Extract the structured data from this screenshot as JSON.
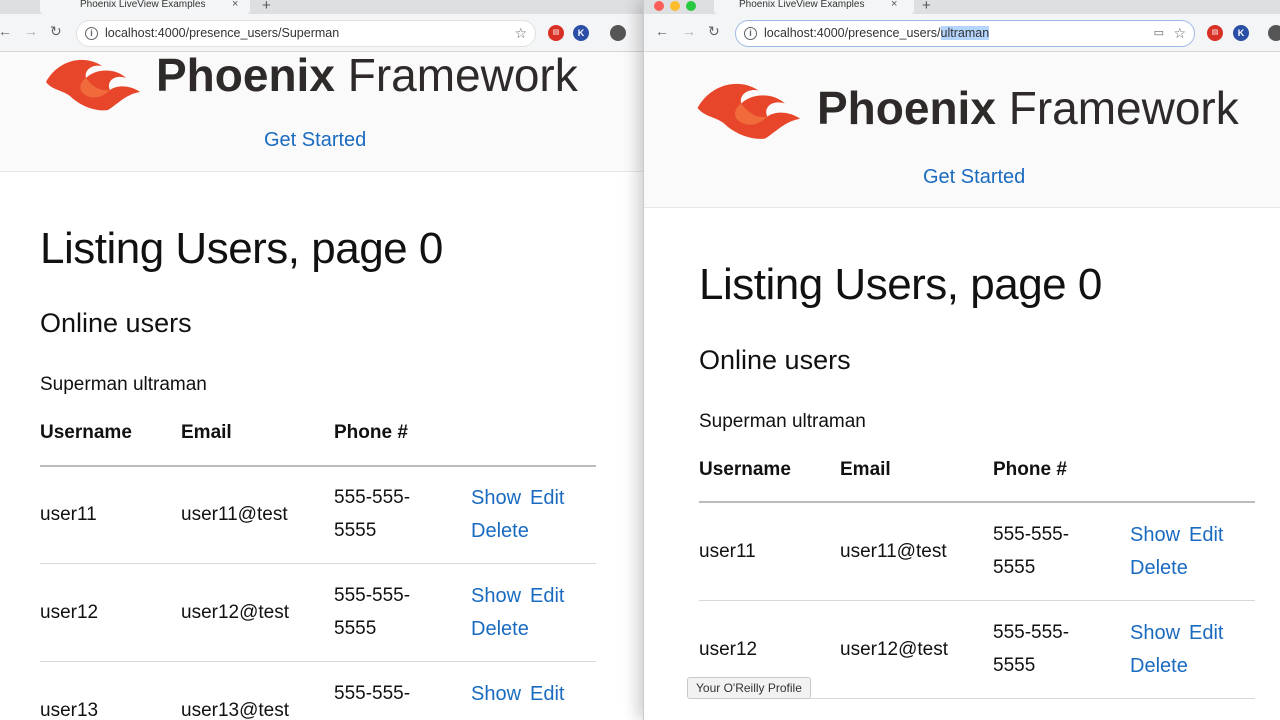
{
  "left": {
    "tab_title": "Phoenix LiveView Examples",
    "url": "localhost:4000/presence_users/Superman",
    "url_selected": ""
  },
  "right": {
    "tab_title": "Phoenix LiveView Examples",
    "url": "localhost:4000/presence_users/",
    "url_selected": "ultraman"
  },
  "site": {
    "logo_bold": "Phoenix",
    "logo_light": "Framework",
    "nav_link": "Get Started"
  },
  "content": {
    "heading": "Listing Users, page 0",
    "online_heading": "Online users",
    "online_users": "Superman ultraman",
    "columns": {
      "username": "Username",
      "email": "Email",
      "phone": "Phone #"
    },
    "rows": [
      {
        "username": "user11",
        "email": "user11@test",
        "phone_1": "555-555-",
        "phone_2": "5555",
        "show": "Show",
        "edit": "Edit",
        "delete": "Delete"
      },
      {
        "username": "user12",
        "email": "user12@test",
        "phone_1": "555-555-",
        "phone_2": "5555",
        "show": "Show",
        "edit": "Edit",
        "delete": "Delete"
      },
      {
        "username": "user13",
        "email": "user13@test",
        "phone_1": "555-555-",
        "phone_2": "",
        "show": "Show",
        "edit": "Edit",
        "delete": ""
      }
    ]
  },
  "tooltip": "Your O'Reilly Profile",
  "extensions": [
    {
      "name": "pdf-extension-icon",
      "letter": "",
      "color": "#d93025"
    },
    {
      "name": "k-extension-icon",
      "letter": "K",
      "color": "#2b4fa6"
    },
    {
      "name": "profile-avatar",
      "letter": "",
      "color": "#555555"
    }
  ]
}
